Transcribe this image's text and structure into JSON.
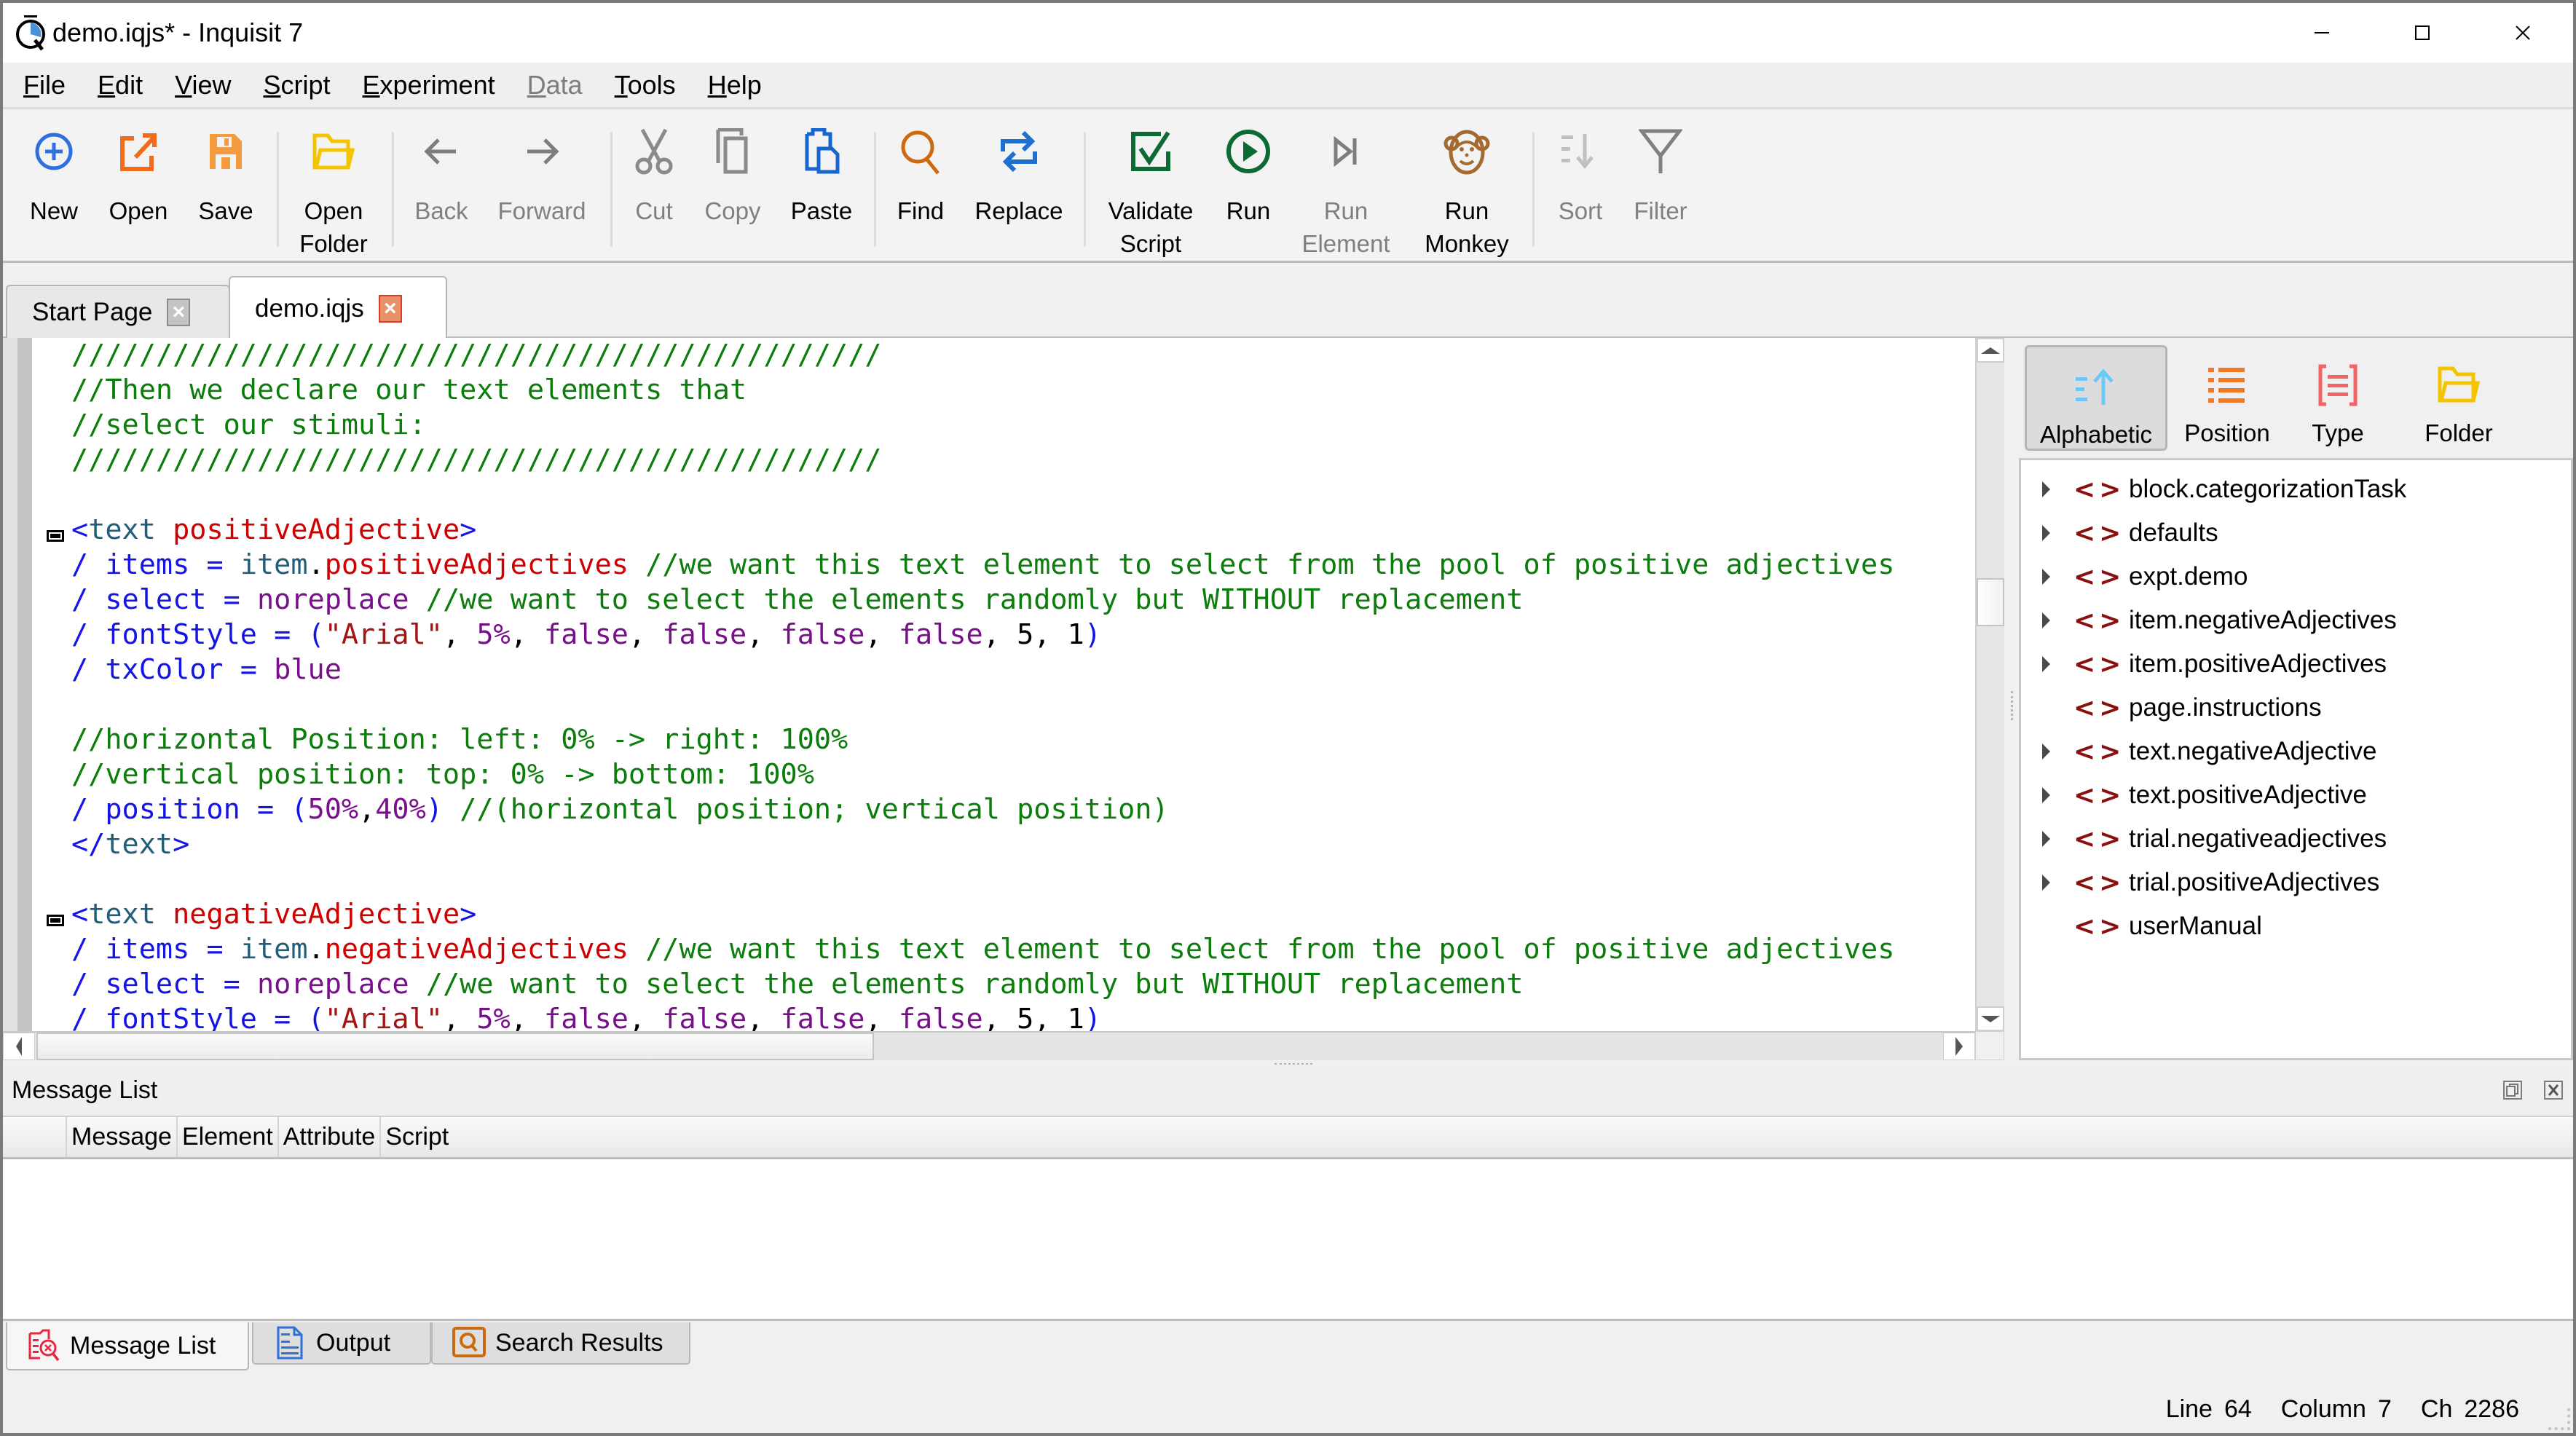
{
  "window": {
    "title": "demo.iqjs* - Inquisit 7",
    "controls": {
      "minimize": "minimize",
      "maximize": "maximize",
      "close": "close"
    }
  },
  "menu": [
    {
      "label": "File",
      "mnemonic": "F",
      "rest": "ile",
      "enabled": true
    },
    {
      "label": "Edit",
      "mnemonic": "E",
      "rest": "dit",
      "enabled": true
    },
    {
      "label": "View",
      "mnemonic": "V",
      "rest": "iew",
      "enabled": true
    },
    {
      "label": "Script",
      "mnemonic": "S",
      "rest": "cript",
      "enabled": true
    },
    {
      "label": "Experiment",
      "mnemonic": "E",
      "pre": "",
      "rest": "xperiment",
      "enabled": true
    },
    {
      "label": "Data",
      "mnemonic": "D",
      "rest": "ata",
      "enabled": false
    },
    {
      "label": "Tools",
      "mnemonic": "T",
      "rest": "ools",
      "enabled": true
    },
    {
      "label": "Help",
      "mnemonic": "H",
      "rest": "elp",
      "enabled": true
    }
  ],
  "toolbar": {
    "new": {
      "label": "New",
      "icon": "new-icon",
      "enabled": true
    },
    "open": {
      "label": "Open",
      "icon": "open-icon",
      "enabled": true
    },
    "save": {
      "label": "Save",
      "icon": "save-icon",
      "enabled": true
    },
    "open_folder": {
      "label1": "Open",
      "label2": "Folder",
      "icon": "folder-icon",
      "enabled": true
    },
    "back": {
      "label": "Back",
      "icon": "arrow-left-icon",
      "enabled": false
    },
    "forward": {
      "label": "Forward",
      "icon": "arrow-right-icon",
      "enabled": false
    },
    "cut": {
      "label": "Cut",
      "icon": "scissors-icon",
      "enabled": false
    },
    "copy": {
      "label": "Copy",
      "icon": "copy-icon",
      "enabled": false
    },
    "paste": {
      "label": "Paste",
      "icon": "paste-icon",
      "enabled": true
    },
    "find": {
      "label": "Find",
      "icon": "search-icon",
      "enabled": true
    },
    "replace": {
      "label": "Replace",
      "icon": "replace-icon",
      "enabled": true
    },
    "validate": {
      "label1": "Validate",
      "label2": "Script",
      "icon": "checkbox-icon",
      "enabled": true
    },
    "run": {
      "label": "Run",
      "icon": "play-icon",
      "enabled": true
    },
    "run_element": {
      "label1": "Run",
      "label2": "Element",
      "icon": "step-icon",
      "enabled": false
    },
    "run_monkey": {
      "label1": "Run",
      "label2": "Monkey",
      "icon": "monkey-icon",
      "enabled": true
    },
    "sort": {
      "label": "Sort",
      "icon": "sort-icon",
      "enabled": false
    },
    "filter": {
      "label": "Filter",
      "icon": "filter-icon",
      "enabled": false
    }
  },
  "doc_tabs": [
    {
      "label": "Start Page",
      "active": false
    },
    {
      "label": "demo.iqjs",
      "active": true
    }
  ],
  "editor": {
    "lines": [
      [
        {
          "t": "////////////////////////////////////////////////",
          "c": "com"
        }
      ],
      [
        {
          "t": "//Then we declare our text elements that",
          "c": "com"
        }
      ],
      [
        {
          "t": "//select our stimuli:",
          "c": "com"
        }
      ],
      [
        {
          "t": "////////////////////////////////////////////////",
          "c": "com"
        }
      ],
      [],
      [
        {
          "t": "<",
          "c": "tag"
        },
        {
          "t": "text",
          "c": "kw"
        },
        {
          "t": " "
        },
        {
          "t": "positiveAdjective",
          "c": "name"
        },
        {
          "t": ">",
          "c": "tag"
        }
      ],
      [
        {
          "t": "/ items",
          "c": "attr"
        },
        {
          "t": " = ",
          "c": "attr"
        },
        {
          "t": "item",
          "c": "kw"
        },
        {
          "t": ".",
          "c": "punc"
        },
        {
          "t": "positiveAdjectives",
          "c": "name"
        },
        {
          "t": " //we want this text element to select from the pool of positive adjectives",
          "c": "com"
        }
      ],
      [
        {
          "t": "/ select",
          "c": "attr"
        },
        {
          "t": " = ",
          "c": "attr"
        },
        {
          "t": "noreplace",
          "c": "val"
        },
        {
          "t": " //we want to select the elements randomly but WITHOUT replacement",
          "c": "com"
        }
      ],
      [
        {
          "t": "/ fontStyle",
          "c": "attr"
        },
        {
          "t": " = (",
          "c": "attr"
        },
        {
          "t": "\"Arial\"",
          "c": "str"
        },
        {
          "t": ", ",
          "c": "punc"
        },
        {
          "t": "5%",
          "c": "val"
        },
        {
          "t": ", ",
          "c": "punc"
        },
        {
          "t": "false",
          "c": "val"
        },
        {
          "t": ", ",
          "c": "punc"
        },
        {
          "t": "false",
          "c": "val"
        },
        {
          "t": ", ",
          "c": "punc"
        },
        {
          "t": "false",
          "c": "val"
        },
        {
          "t": ", ",
          "c": "punc"
        },
        {
          "t": "false",
          "c": "val"
        },
        {
          "t": ", 5, 1",
          "c": "num"
        },
        {
          "t": ")",
          "c": "attr"
        }
      ],
      [
        {
          "t": "/ txColor",
          "c": "attr"
        },
        {
          "t": " = ",
          "c": "attr"
        },
        {
          "t": "blue",
          "c": "val"
        }
      ],
      [],
      [
        {
          "t": "//horizontal Position: left: 0% -> right: 100%",
          "c": "com"
        }
      ],
      [
        {
          "t": "//vertical position: top: 0% -> bottom: 100%",
          "c": "com"
        }
      ],
      [
        {
          "t": "/ position",
          "c": "attr"
        },
        {
          "t": " = (",
          "c": "attr"
        },
        {
          "t": "50%",
          "c": "val"
        },
        {
          "t": ",",
          "c": "punc"
        },
        {
          "t": "40%",
          "c": "val"
        },
        {
          "t": ")",
          "c": "attr"
        },
        {
          "t": " //(horizontal position; vertical position)",
          "c": "com"
        }
      ],
      [
        {
          "t": "</",
          "c": "tag"
        },
        {
          "t": "text",
          "c": "kw"
        },
        {
          "t": ">",
          "c": "tag"
        }
      ],
      [],
      [
        {
          "t": "<",
          "c": "tag"
        },
        {
          "t": "text",
          "c": "kw"
        },
        {
          "t": " "
        },
        {
          "t": "negativeAdjective",
          "c": "name"
        },
        {
          "t": ">",
          "c": "tag"
        }
      ],
      [
        {
          "t": "/ items",
          "c": "attr"
        },
        {
          "t": " = ",
          "c": "attr"
        },
        {
          "t": "item",
          "c": "kw"
        },
        {
          "t": ".",
          "c": "punc"
        },
        {
          "t": "negativeAdjectives",
          "c": "name"
        },
        {
          "t": " //we want this text element to select from the pool of positive adjectives",
          "c": "com"
        }
      ],
      [
        {
          "t": "/ select",
          "c": "attr"
        },
        {
          "t": " = ",
          "c": "attr"
        },
        {
          "t": "noreplace",
          "c": "val"
        },
        {
          "t": " //we want to select the elements randomly but WITHOUT replacement",
          "c": "com"
        }
      ],
      [
        {
          "t": "/ fontStyle",
          "c": "attr"
        },
        {
          "t": " = (",
          "c": "attr"
        },
        {
          "t": "\"Arial\"",
          "c": "str"
        },
        {
          "t": ", ",
          "c": "punc"
        },
        {
          "t": "5%",
          "c": "val"
        },
        {
          "t": ", ",
          "c": "punc"
        },
        {
          "t": "false",
          "c": "val"
        },
        {
          "t": ", ",
          "c": "punc"
        },
        {
          "t": "false",
          "c": "val"
        },
        {
          "t": ", ",
          "c": "punc"
        },
        {
          "t": "false",
          "c": "val"
        },
        {
          "t": ", ",
          "c": "punc"
        },
        {
          "t": "false",
          "c": "val"
        },
        {
          "t": ", 5, 1",
          "c": "num"
        },
        {
          "t": ")",
          "c": "attr"
        }
      ]
    ],
    "fold_lines": [
      5,
      16
    ]
  },
  "element_browser": {
    "sort_modes": [
      {
        "label": "Alphabetic",
        "icon": "sort-alpha-icon",
        "active": true
      },
      {
        "label": "Position",
        "icon": "list-icon",
        "active": false
      },
      {
        "label": "Type",
        "icon": "type-icon",
        "active": false
      },
      {
        "label": "Folder",
        "icon": "folder-icon",
        "active": false
      }
    ],
    "items": [
      {
        "label": "block.categorizationTask",
        "expandable": true
      },
      {
        "label": "defaults",
        "expandable": true
      },
      {
        "label": "expt.demo",
        "expandable": true
      },
      {
        "label": "item.negativeAdjectives",
        "expandable": true
      },
      {
        "label": "item.positiveAdjectives",
        "expandable": true
      },
      {
        "label": "page.instructions",
        "expandable": false
      },
      {
        "label": "text.negativeAdjective",
        "expandable": true
      },
      {
        "label": "text.positiveAdjective",
        "expandable": true
      },
      {
        "label": "trial.negativeadjectives",
        "expandable": true
      },
      {
        "label": "trial.positiveAdjectives",
        "expandable": true
      },
      {
        "label": "userManual",
        "expandable": false
      }
    ]
  },
  "message_list": {
    "title": "Message List",
    "columns": [
      "Message",
      "Element",
      "Attribute",
      "Script"
    ],
    "rows": []
  },
  "bottom_tabs": [
    {
      "label": "Message List",
      "icon": "message-list-icon",
      "active": true
    },
    {
      "label": "Output",
      "icon": "document-icon",
      "active": false
    },
    {
      "label": "Search Results",
      "icon": "search-results-icon",
      "active": false
    }
  ],
  "status": {
    "line_label": "Line",
    "line_value": "64",
    "column_label": "Column",
    "column_value": "7",
    "ch_label": "Ch",
    "ch_value": "2286"
  },
  "colors": {
    "comment": "#0b7d0b",
    "tag": "#1414e6",
    "keyword": "#1f5f7a",
    "element_name": "#d00000",
    "value": "#7a0f8e",
    "string": "#a31515",
    "tree_icon": "#8a1010"
  }
}
